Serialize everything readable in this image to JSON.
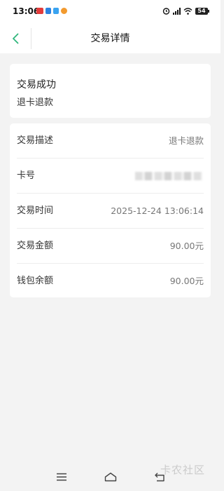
{
  "status_bar": {
    "time": "13:06",
    "battery": "54"
  },
  "header": {
    "title": "交易详情"
  },
  "summary": {
    "status": "交易成功",
    "type": "退卡退款"
  },
  "details": [
    {
      "label": "交易描述",
      "value": "退卡退款"
    },
    {
      "label": "卡号",
      "value": ""
    },
    {
      "label": "交易时间",
      "value": "2025-12-24 13:06:14"
    },
    {
      "label": "交易金额",
      "value": "90.00元"
    },
    {
      "label": "钱包余额",
      "value": "90.00元"
    }
  ],
  "watermark": "卡农社区",
  "colors": {
    "accent": "#2fb67c",
    "background": "#f3f3f3",
    "card": "#ffffff"
  }
}
